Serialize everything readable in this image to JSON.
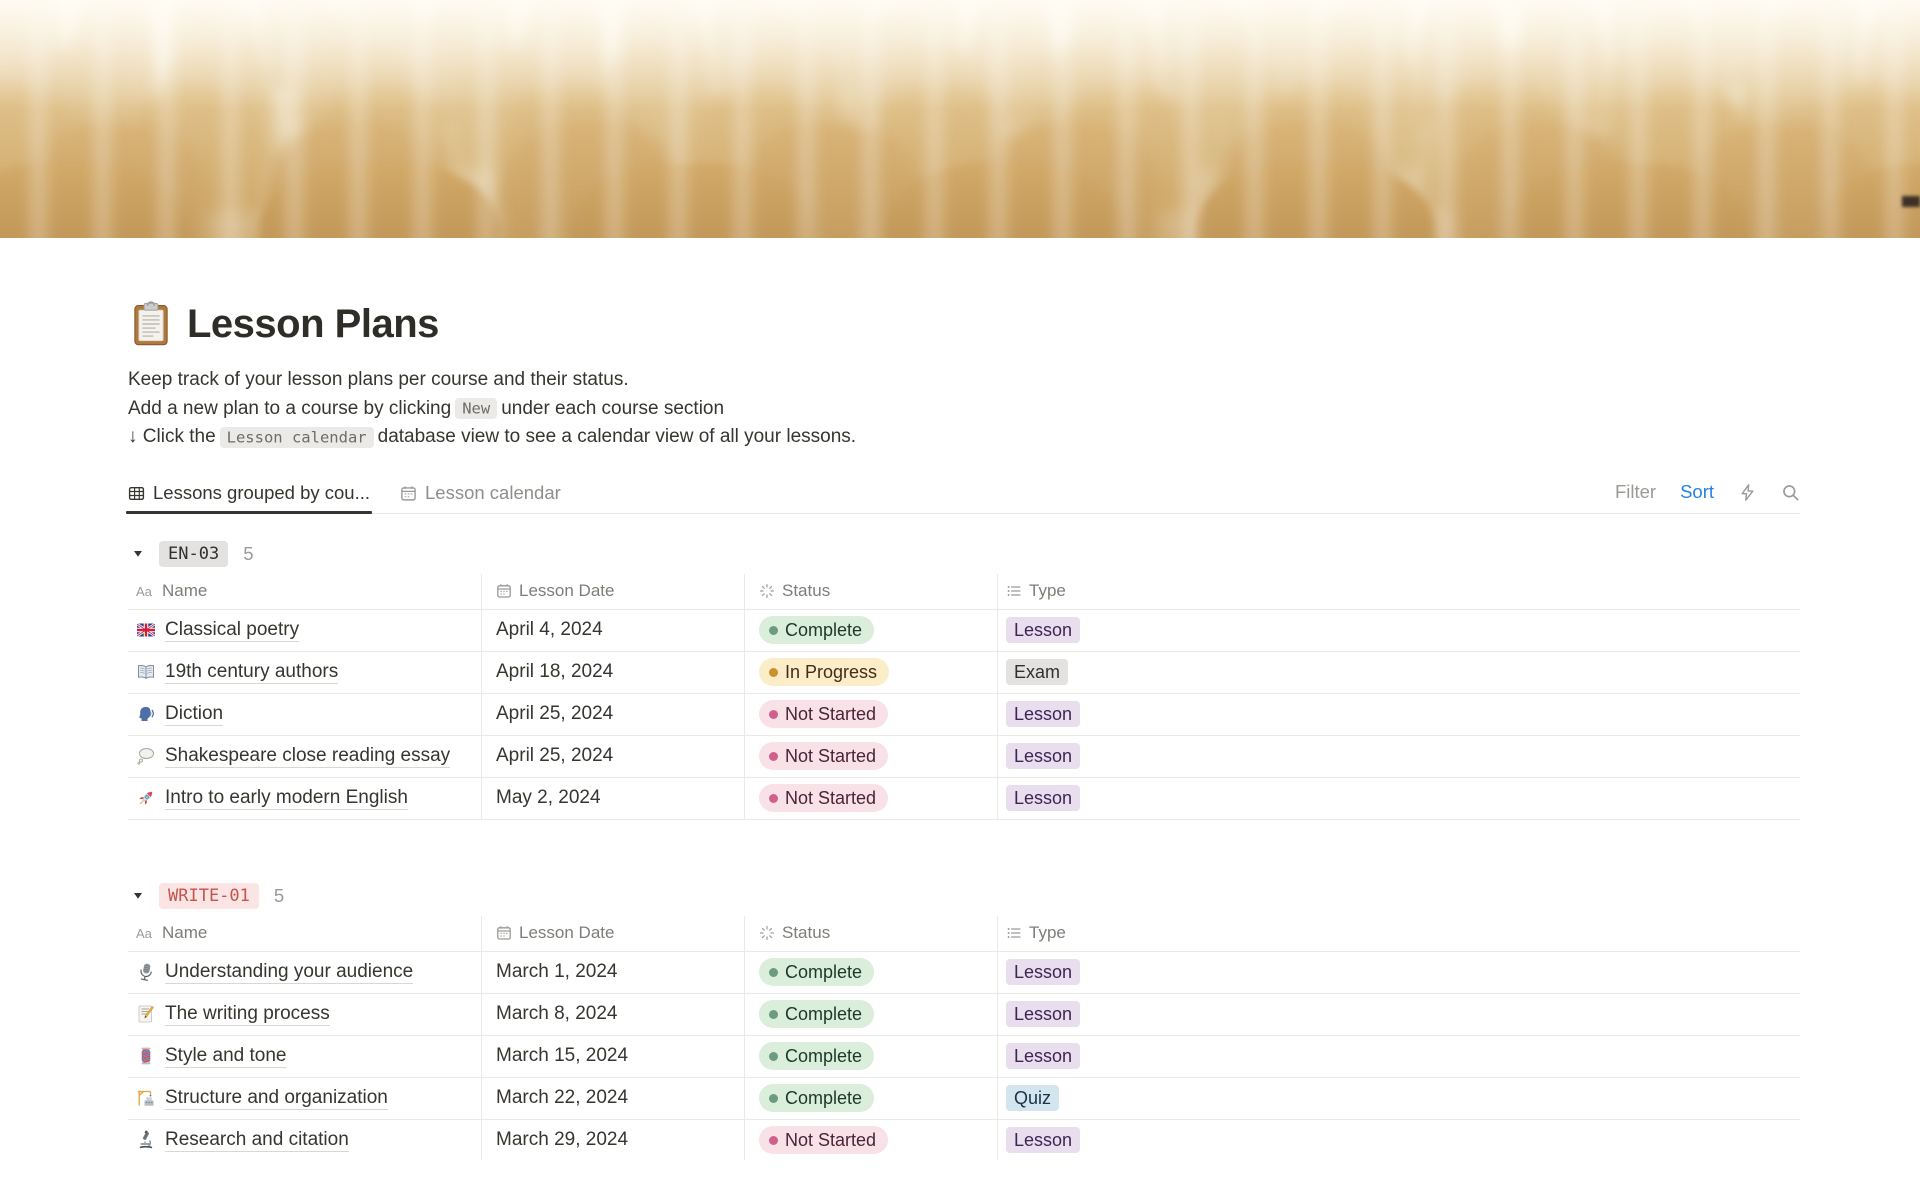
{
  "page": {
    "icon": "clipboard-icon",
    "title": "Lesson Plans"
  },
  "description": {
    "line1": "Keep track of your lesson plans per course and their status.",
    "line2_pre": "Add a new plan to a course by clicking",
    "line2_chip": "New",
    "line2_post": "under each course section",
    "line3_pre": "↓ Click the",
    "line3_chip": "Lesson calendar",
    "line3_post": "database view to see a calendar view of all your lessons."
  },
  "toolbar": {
    "tabs": [
      {
        "label": "Lessons grouped by cou...",
        "icon": "table-view-icon",
        "active": true
      },
      {
        "label": "Lesson calendar",
        "icon": "calendar-icon",
        "active": false
      }
    ],
    "filter_label": "Filter",
    "sort_label": "Sort",
    "bolt_icon": "bolt-icon",
    "search_icon": "search-icon"
  },
  "table": {
    "group_toggle_icon": "triangle-down-icon",
    "columns": [
      {
        "icon": "aa-icon",
        "label": "Name"
      },
      {
        "icon": "calendar-icon",
        "label": "Lesson Date"
      },
      {
        "icon": "status-burst-icon",
        "label": "Status"
      },
      {
        "icon": "list-icon",
        "label": "Type"
      }
    ]
  },
  "groups": [
    {
      "name": "EN-03",
      "count": "5",
      "color": "gray",
      "rows": [
        {
          "icon": "uk-flag-icon",
          "name": "Classical poetry",
          "date": "April 4, 2024",
          "status": "Complete",
          "status_color": "green",
          "type": "Lesson",
          "type_color": "purple"
        },
        {
          "icon": "open-book-icon",
          "name": "19th century authors",
          "date": "April 18, 2024",
          "status": "In Progress",
          "status_color": "yellow",
          "type": "Exam",
          "type_color": "gray"
        },
        {
          "icon": "speaking-head-icon",
          "name": "Diction",
          "date": "April 25, 2024",
          "status": "Not Started",
          "status_color": "pink",
          "type": "Lesson",
          "type_color": "purple"
        },
        {
          "icon": "thought-balloon-icon",
          "name": "Shakespeare close reading essay",
          "date": "April 25, 2024",
          "status": "Not Started",
          "status_color": "pink",
          "type": "Lesson",
          "type_color": "purple"
        },
        {
          "icon": "rocket-icon",
          "name": "Intro to early modern English",
          "date": "May 2, 2024",
          "status": "Not Started",
          "status_color": "pink",
          "type": "Lesson",
          "type_color": "purple"
        }
      ]
    },
    {
      "name": "WRITE-01",
      "count": "5",
      "color": "red",
      "rows": [
        {
          "icon": "microphone-icon",
          "name": "Understanding your audience",
          "date": "March 1, 2024",
          "status": "Complete",
          "status_color": "green",
          "type": "Lesson",
          "type_color": "purple"
        },
        {
          "icon": "memo-icon",
          "name": "The writing process",
          "date": "March 8, 2024",
          "status": "Complete",
          "status_color": "green",
          "type": "Lesson",
          "type_color": "purple"
        },
        {
          "icon": "barber-pole-icon",
          "name": "Style and tone",
          "date": "March 15, 2024",
          "status": "Complete",
          "status_color": "green",
          "type": "Lesson",
          "type_color": "purple"
        },
        {
          "icon": "crane-icon",
          "name": "Structure and organization",
          "date": "March 22, 2024",
          "status": "Complete",
          "status_color": "green",
          "type": "Quiz",
          "type_color": "blue"
        },
        {
          "icon": "microscope-icon",
          "name": "Research and citation",
          "date": "March 29, 2024",
          "status": "Not Started",
          "status_color": "pink",
          "type": "Lesson",
          "type_color": "purple"
        }
      ]
    }
  ],
  "colors": {
    "status": {
      "green": {
        "bg": "#DBEDDB",
        "dot": "#6C9B7D",
        "text": "#1C3829"
      },
      "yellow": {
        "bg": "#FDECC8",
        "dot": "#CB912F",
        "text": "#402C1B"
      },
      "pink": {
        "bg": "#F8E1E7",
        "dot": "#D0618D",
        "text": "#4C2337"
      }
    },
    "type": {
      "purple": {
        "bg": "#E8DEEE",
        "text": "#412454"
      },
      "gray": {
        "bg": "#E3E2E0",
        "text": "#32302C"
      },
      "blue": {
        "bg": "#D3E5EF",
        "text": "#183347"
      }
    },
    "group": {
      "gray": {
        "bg": "#E3E2E0",
        "text": "#32302C"
      },
      "red": {
        "bg": "#FBE4E4",
        "text": "#C4554D"
      }
    },
    "accent_sort": "#2383E2"
  }
}
